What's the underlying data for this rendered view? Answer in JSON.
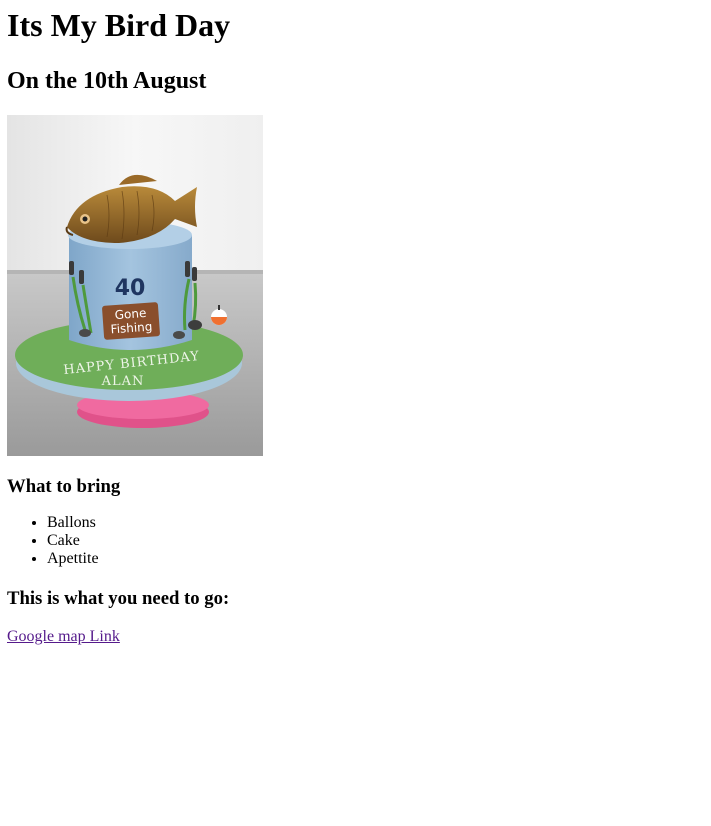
{
  "page": {
    "title": "Its My Bird Day",
    "subtitle": "On the 10th August"
  },
  "photo": {
    "cake_number": "40",
    "sign_line1": "Gone",
    "sign_line2": "Fishing",
    "banner_line1": "HAPPY BIRTHDAY",
    "banner_line2": "ALAN"
  },
  "bring": {
    "heading": "What to bring",
    "items": [
      "Ballons",
      "Cake",
      "Apettite"
    ]
  },
  "directions": {
    "heading": "This is what you need to go:",
    "link_label": "Google map Link"
  }
}
